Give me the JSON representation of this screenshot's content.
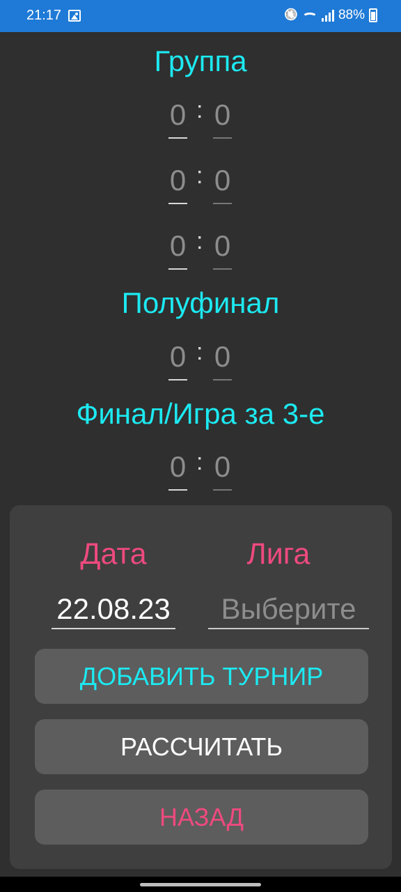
{
  "status_bar": {
    "time": "21:17",
    "battery": "88%",
    "icons": [
      "image-icon",
      "mute-icon",
      "wifi-icon",
      "signal-icon",
      "battery-icon"
    ]
  },
  "sections": {
    "group": "Группа",
    "semifinal": "Полуфинал",
    "final": "Финал/Игра за 3-е"
  },
  "scores": {
    "group": [
      {
        "left": "0",
        "right": "0"
      },
      {
        "left": "0",
        "right": "0"
      },
      {
        "left": "0",
        "right": "0"
      }
    ],
    "semifinal": [
      {
        "left": "0",
        "right": "0"
      }
    ],
    "final": [
      {
        "left": "0",
        "right": "0"
      }
    ],
    "separator": ":"
  },
  "panel": {
    "date_label": "Дата",
    "league_label": "Лига",
    "date_value": "22.08.23",
    "league_placeholder": "Выберите",
    "add_tournament": "ДОБАВИТЬ ТУРНИР",
    "calculate": "РАССЧИТАТЬ",
    "back": "НАЗАД"
  },
  "colors": {
    "status_bar": "#1e7ad6",
    "background": "#2f2f2f",
    "heading": "#1de9f1",
    "accent_pink": "#ee4a7f",
    "panel": "#3f3f3f",
    "button": "#5d5d5d"
  }
}
